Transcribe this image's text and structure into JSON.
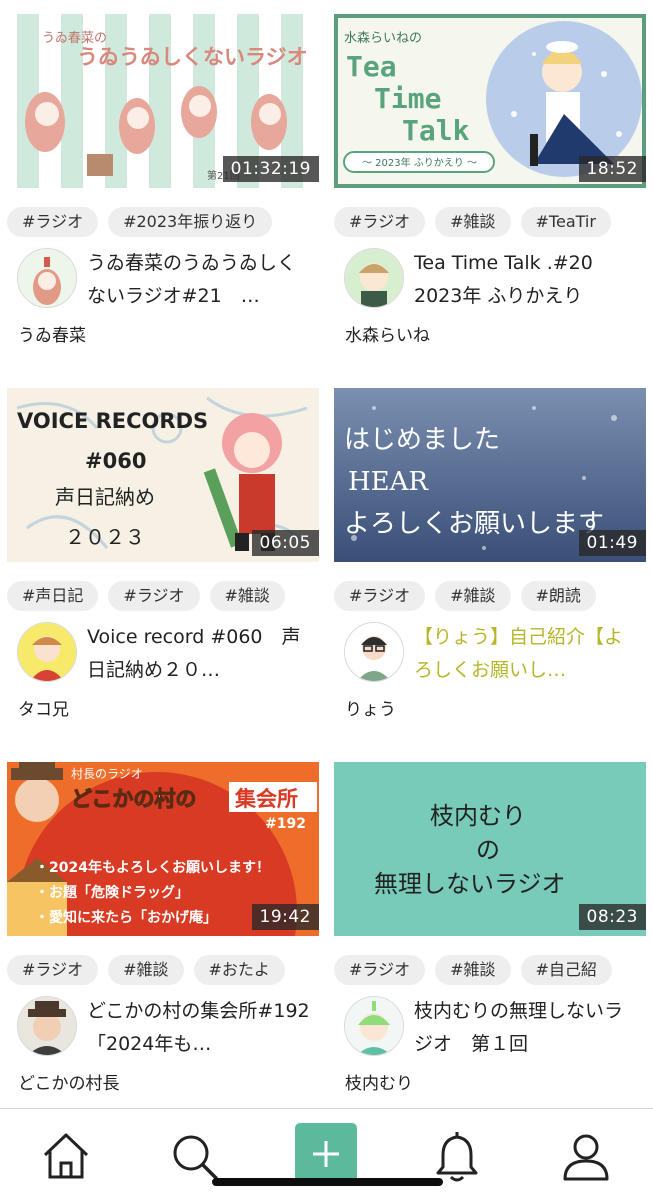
{
  "cards": [
    {
      "duration": "01:32:19",
      "tags": [
        "#ラジオ",
        "#2023年振り返り"
      ],
      "title": "うゐ春菜のうゐうゐしくないラジオ#21　…",
      "author": "うゐ春菜",
      "thumb_text": [
        "うゐ春菜の",
        "うゐうゐしくないラジオ",
        "第21回"
      ],
      "title_style": "normal"
    },
    {
      "duration": "18:52",
      "tags": [
        "#ラジオ",
        "#雑談",
        "#TeaTir"
      ],
      "title": "Tea Time Talk .#20 2023年 ふりかえり",
      "author": "水森らいね",
      "thumb_text": [
        "水森らいねの",
        "Tea",
        "Time",
        "Talk",
        "～ 2023年 ふりかえり ～"
      ],
      "title_style": "normal"
    },
    {
      "duration": "06:05",
      "tags": [
        "#声日記",
        "#ラジオ",
        "#雑談"
      ],
      "title": "Voice record #060　声日記納め２０…",
      "author": "タコ兄",
      "thumb_text": [
        "VOICE RECORDS",
        "#060",
        "声日記納め",
        "２０２３"
      ],
      "title_style": "normal"
    },
    {
      "duration": "01:49",
      "tags": [
        "#ラジオ",
        "#雑談",
        "#朗読"
      ],
      "title": "【りょう】自己紹介【よろしくお願いし…",
      "author": "りょう",
      "thumb_text": [
        "はじめました",
        "HEAR",
        "よろしくお願いします"
      ],
      "title_style": "yellow"
    },
    {
      "duration": "19:42",
      "tags": [
        "#ラジオ",
        "#雑談",
        "#おたよ"
      ],
      "title": "どこかの村の集会所#192「2024年も…",
      "author": "どこかの村長",
      "thumb_text": [
        "村長のラジオ",
        "どこかの村の",
        "集会所",
        "#192",
        "・2024年もよろしくお願いします！",
        "・お題「危険ドラッグ」",
        "・愛知に来たら「おかげ庵」"
      ],
      "title_style": "normal"
    },
    {
      "duration": "08:23",
      "tags": [
        "#ラジオ",
        "#雑談",
        "#自己紹"
      ],
      "title": "枝内むりの無理しないラジオ　第１回",
      "author": "枝内むり",
      "thumb_text": [
        "枝内むり",
        "の",
        "無理しないラジオ"
      ],
      "title_style": "normal"
    }
  ],
  "tabbar": {
    "items": [
      "home-icon",
      "search-icon",
      "add-icon",
      "bell-icon",
      "profile-icon"
    ],
    "accent": "#5cb99c"
  }
}
